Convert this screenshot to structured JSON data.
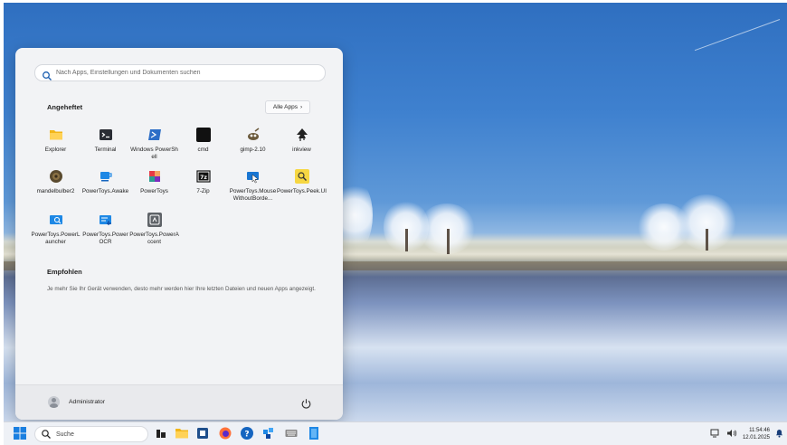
{
  "start_menu": {
    "search_placeholder": "Nach Apps, Einstellungen und Dokumenten suchen",
    "pinned_title": "Angeheftet",
    "all_apps_label": "Alle Apps",
    "apps": [
      {
        "label": "Explorer",
        "icon": "folder-icon"
      },
      {
        "label": "Terminal",
        "icon": "terminal-icon"
      },
      {
        "label": "Windows PowerShell",
        "icon": "powershell-icon"
      },
      {
        "label": "cmd",
        "icon": "cmd-icon"
      },
      {
        "label": "gimp-2.10",
        "icon": "gimp-icon"
      },
      {
        "label": "inkview",
        "icon": "inkscape-icon"
      },
      {
        "label": "mandelbulber2",
        "icon": "mandelbulber-icon"
      },
      {
        "label": "PowerToys.Awake",
        "icon": "coffee-cup-icon"
      },
      {
        "label": "PowerToys",
        "icon": "powertoys-icon"
      },
      {
        "label": "7-Zip",
        "icon": "7zip-icon"
      },
      {
        "label": "PowerToys.MouseWithoutBorde...",
        "icon": "mouse-without-borders-icon"
      },
      {
        "label": "PowerToys.Peek.UI",
        "icon": "peek-icon"
      },
      {
        "label": "PowerToys.PowerLauncher",
        "icon": "launcher-icon"
      },
      {
        "label": "PowerToys.PowerOCR",
        "icon": "ocr-icon"
      },
      {
        "label": "PowerToys.PowerAccent",
        "icon": "accent-icon"
      }
    ],
    "recommended_title": "Empfohlen",
    "recommended_text": "Je mehr Sie Ihr Gerät verwenden, desto mehr werden hier Ihre letzten Dateien und neuen Apps angezeigt.",
    "user_name": "Administrator"
  },
  "taskbar": {
    "search_label": "Suche",
    "time": "11:54:46",
    "date": "12.01.2025"
  }
}
